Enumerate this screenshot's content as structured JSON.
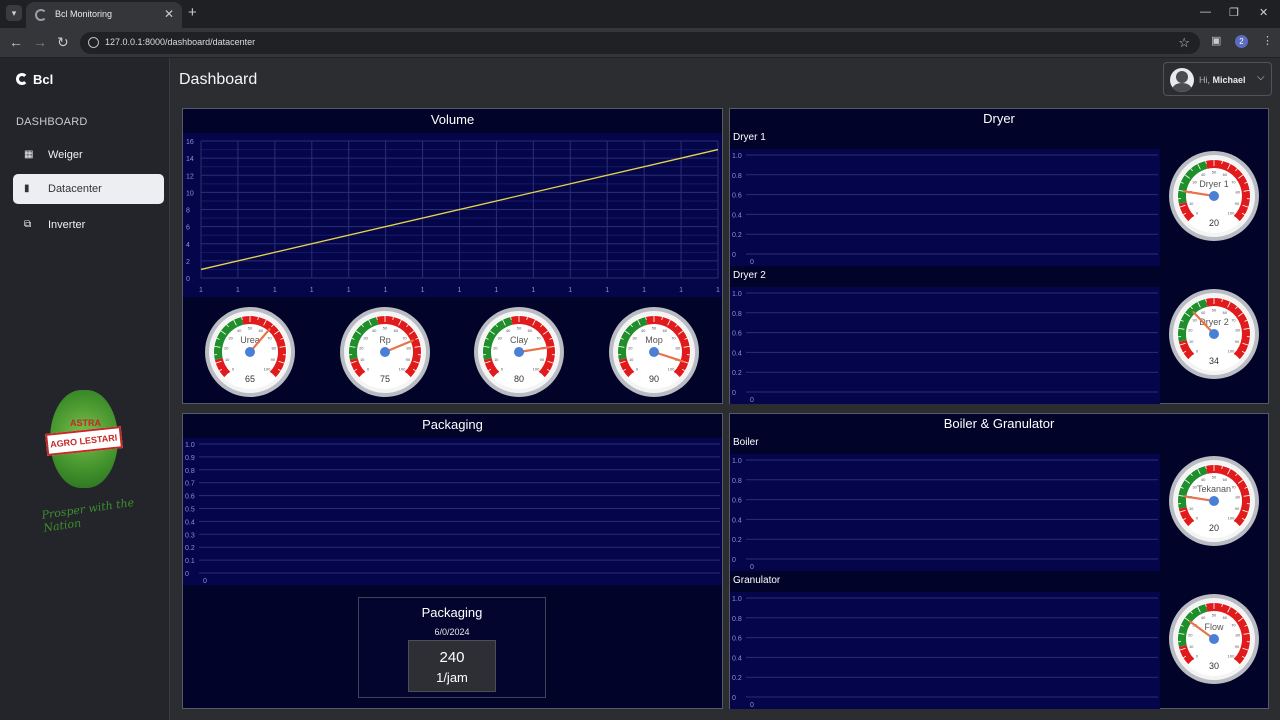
{
  "browser": {
    "tab_title": "Bcl Monitoring",
    "url": "127.0.0.1:8000/dashboard/datacenter",
    "profile_number": "2"
  },
  "sidebar": {
    "brand": "Bcl",
    "section": "DASHBOARD",
    "items": [
      {
        "label": "Weiger",
        "icon": "grid-icon"
      },
      {
        "label": "Datacenter",
        "icon": "bar-chart-icon",
        "active": true
      },
      {
        "label": "Inverter",
        "icon": "inverter-icon"
      }
    ],
    "logo_text": {
      "top": "ASTRA",
      "band": "AGRO LESTARI"
    },
    "slogan": "Prosper with the Nation"
  },
  "header": {
    "title": "Dashboard",
    "user": {
      "greeting": "Hi,",
      "name": "Michael"
    }
  },
  "colors": {
    "panel_bg": "#010428",
    "plot_bg": "#04054a",
    "line": "#e6d54a",
    "gauge_green": "#1e8f2a",
    "gauge_red": "#e11b1b",
    "needle": "#e8734a",
    "hub": "#4a7fd6"
  },
  "volume": {
    "title": "Volume",
    "chart_data": {
      "type": "line",
      "y_ticks": [
        "0",
        "2",
        "4",
        "6",
        "8",
        "10",
        "12",
        "14",
        "16"
      ],
      "x_ticks": [
        "1",
        "1",
        "1",
        "1",
        "1",
        "1",
        "1",
        "1",
        "1",
        "1",
        "1",
        "1",
        "1",
        "1",
        "1"
      ],
      "ylim": [
        0,
        16
      ],
      "values_start": 1,
      "values_end": 15,
      "grid": true
    },
    "gauges": [
      {
        "label": "Urea",
        "value": "65",
        "num": 65
      },
      {
        "label": "Rp",
        "value": "75",
        "num": 75
      },
      {
        "label": "Clay",
        "value": "80",
        "num": 80
      },
      {
        "label": "Mop",
        "value": "90",
        "num": 90
      }
    ]
  },
  "dryer": {
    "title": "Dryer",
    "charts": [
      {
        "label": "Dryer 1",
        "y_ticks": [
          "0",
          "0.2",
          "0.4",
          "0.6",
          "0.8",
          "1.0"
        ],
        "x_tick": "0"
      },
      {
        "label": "Dryer 2",
        "y_ticks": [
          "0",
          "0.2",
          "0.4",
          "0.6",
          "0.8",
          "1.0"
        ],
        "x_tick": "0"
      }
    ],
    "gauges": [
      {
        "label": "Dryer 1",
        "value": "20",
        "num": 20
      },
      {
        "label": "Dryer 2",
        "value": "34",
        "num": 34
      }
    ]
  },
  "packaging": {
    "title": "Packaging",
    "chart": {
      "y_ticks": [
        "0",
        "0.1",
        "0.2",
        "0.3",
        "0.4",
        "0.5",
        "0.6",
        "0.7",
        "0.8",
        "0.9",
        "1.0"
      ],
      "x_tick": "0"
    },
    "card": {
      "title": "Packaging",
      "date": "6/0/2024",
      "value": "240",
      "unit": "1/jam"
    }
  },
  "boiler": {
    "title": "Boiler & Granulator",
    "charts": [
      {
        "label": "Boiler",
        "y_ticks": [
          "0",
          "0.2",
          "0.4",
          "0.6",
          "0.8",
          "1.0"
        ],
        "x_tick": "0"
      },
      {
        "label": "Granulator",
        "y_ticks": [
          "0",
          "0.2",
          "0.4",
          "0.6",
          "0.8",
          "1.0"
        ],
        "x_tick": "0"
      }
    ],
    "gauges": [
      {
        "label": "Tekanan",
        "value": "20",
        "num": 20
      },
      {
        "label": "Flow",
        "value": "30",
        "num": 30
      }
    ]
  },
  "gauge_scale": [
    "0",
    "10",
    "20",
    "30",
    "40",
    "50",
    "60",
    "70",
    "80",
    "90",
    "100"
  ]
}
